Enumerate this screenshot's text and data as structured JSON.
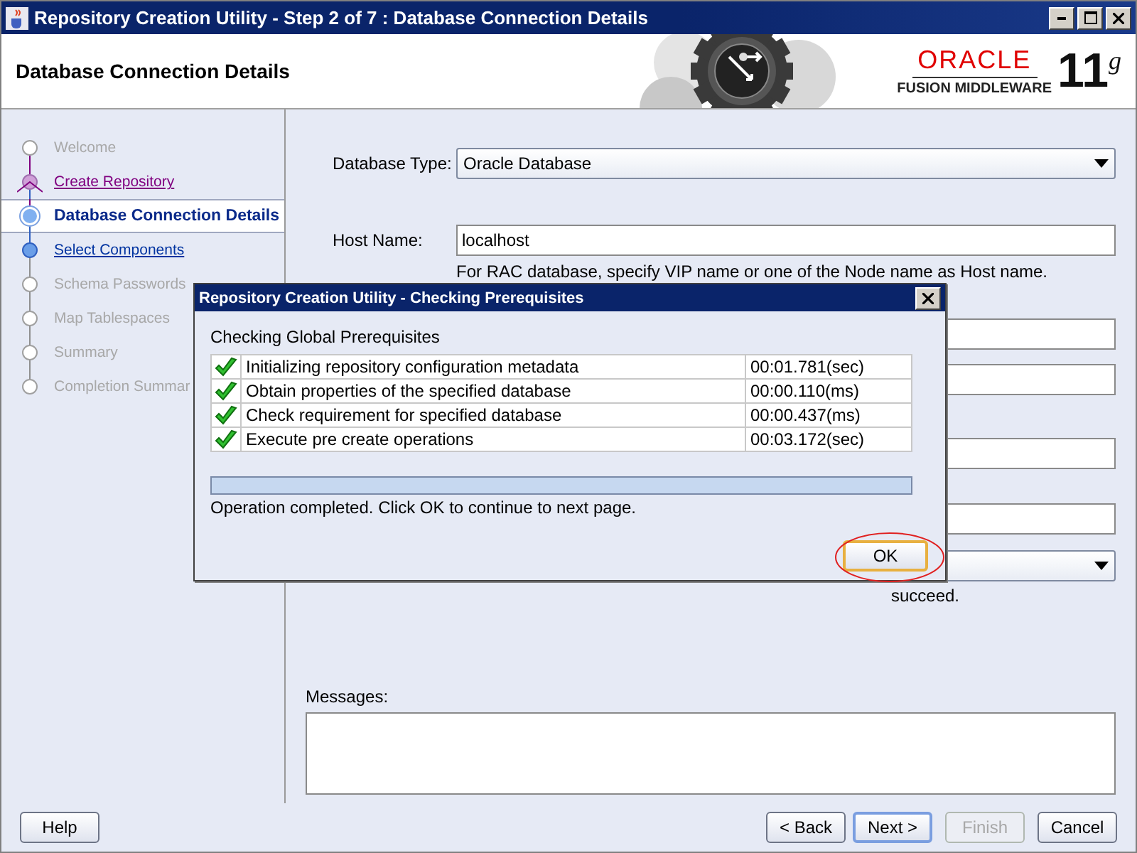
{
  "window": {
    "title": "Repository Creation Utility - Step 2 of 7 : Database Connection Details"
  },
  "header": {
    "title": "Database Connection Details",
    "logo": {
      "brand": "ORACLE",
      "product": "FUSION MIDDLEWARE",
      "version": "11",
      "version_sup": "g"
    }
  },
  "steps": [
    {
      "label": "Welcome",
      "kind": "pending",
      "selected": false
    },
    {
      "label": "Create Repository",
      "kind": "visited",
      "selected": false
    },
    {
      "label": "Database Connection Details",
      "kind": "current",
      "selected": true
    },
    {
      "label": "Select Components",
      "kind": "next",
      "selected": false
    },
    {
      "label": "Schema Passwords",
      "kind": "pending",
      "selected": false
    },
    {
      "label": "Map Tablespaces",
      "kind": "pending",
      "selected": false
    },
    {
      "label": "Summary",
      "kind": "pending",
      "selected": false
    },
    {
      "label": "Completion Summar",
      "kind": "pending",
      "selected": false
    }
  ],
  "form": {
    "database_type": {
      "label": "Database Type:",
      "value": "Oracle Database"
    },
    "host_name": {
      "label": "Host Name:",
      "value": "localhost",
      "hint": "For RAC database, specify VIP name or one of the Node name as Host name."
    },
    "obscured_fields": [
      {
        "kind": "text"
      },
      {
        "kind": "text"
      },
      {
        "kind": "text"
      },
      {
        "kind": "text"
      },
      {
        "kind": "dropdown",
        "note": "succeed."
      }
    ]
  },
  "messages": {
    "label": "Messages:"
  },
  "dialog": {
    "title": "Repository Creation Utility - Checking Prerequisites",
    "heading": "Checking Global Prerequisites",
    "checks": [
      {
        "name": "Initializing repository configuration metadata",
        "time": "00:01.781(sec)",
        "passed": true
      },
      {
        "name": "Obtain properties of the specified database",
        "time": "00:00.110(ms)",
        "passed": true
      },
      {
        "name": "Check requirement for specified database",
        "time": "00:00.437(ms)",
        "passed": true
      },
      {
        "name": "Execute pre create operations",
        "time": "00:03.172(sec)",
        "passed": true
      }
    ],
    "progress": {
      "level": 1
    },
    "status": "Operation completed. Click OK to continue to next page.",
    "ok_button": {
      "label": "OK",
      "highlighted": true
    }
  },
  "buttons": [
    {
      "label": "Help",
      "disabled": false,
      "focused": false
    },
    {
      "label": "< Back",
      "disabled": false,
      "focused": false
    },
    {
      "label": "Next >",
      "disabled": false,
      "focused": true
    },
    {
      "label": "Finish",
      "disabled": true,
      "focused": false
    },
    {
      "label": "Cancel",
      "disabled": false,
      "focused": false
    }
  ]
}
